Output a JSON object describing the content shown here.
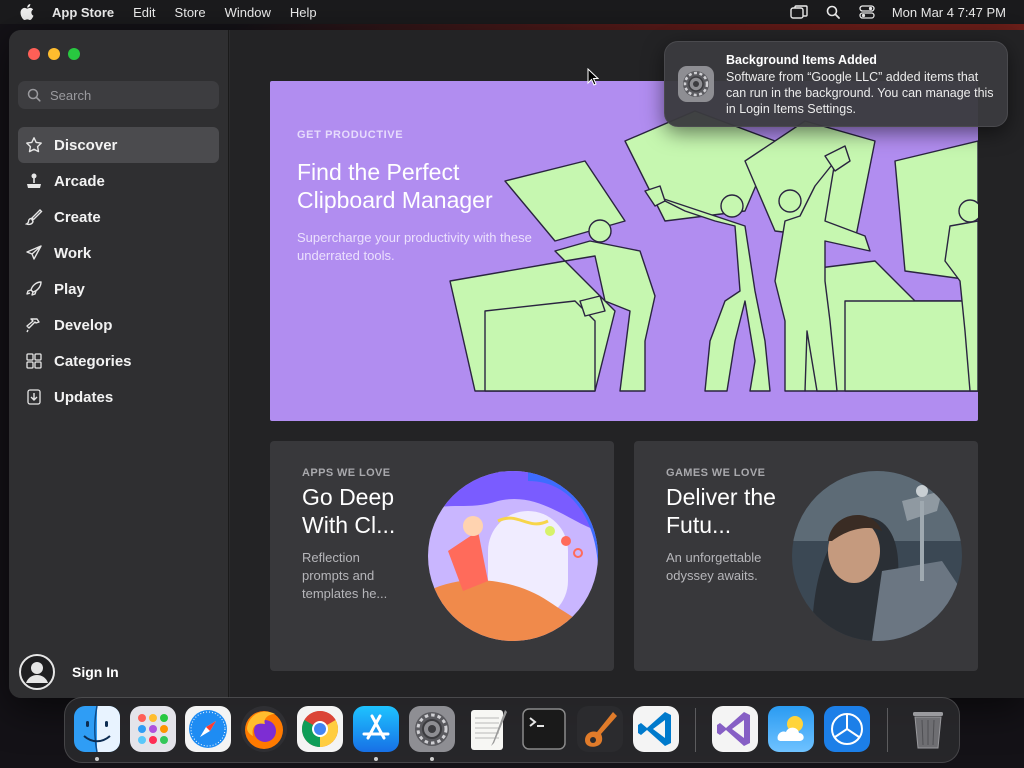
{
  "menubar": {
    "app": "App Store",
    "items": [
      "Edit",
      "Store",
      "Window",
      "Help"
    ],
    "clock": "Mon Mar 4  7:47 PM",
    "status_icons": [
      "screen-mirroring-icon",
      "spotlight-icon",
      "control-center-icon"
    ]
  },
  "sidebar": {
    "search_placeholder": "Search",
    "items": [
      {
        "label": "Discover",
        "icon": "star-icon",
        "active": true
      },
      {
        "label": "Arcade",
        "icon": "joystick-icon"
      },
      {
        "label": "Create",
        "icon": "brush-icon"
      },
      {
        "label": "Work",
        "icon": "paper-plane-icon"
      },
      {
        "label": "Play",
        "icon": "rocket-icon"
      },
      {
        "label": "Develop",
        "icon": "hammer-icon"
      },
      {
        "label": "Categories",
        "icon": "grid-icon"
      },
      {
        "label": "Updates",
        "icon": "download-icon"
      }
    ],
    "sign_in": "Sign In"
  },
  "hero": {
    "eyebrow": "GET PRODUCTIVE",
    "title": "Find the Perfect Clipboard Manager",
    "description": "Supercharge your productivity with these underrated tools.",
    "bg_color": "#b18df0",
    "art_color": "#c6f7b0"
  },
  "cards": [
    {
      "eyebrow": "APPS WE LOVE",
      "title": "Go Deep With Cl...",
      "description": "Reflection prompts and templates he..."
    },
    {
      "eyebrow": "GAMES WE LOVE",
      "title": "Deliver the Futu...",
      "description": "An unforgettable odyssey awaits."
    }
  ],
  "notification": {
    "title": "Background Items Added",
    "body": "Software from “Google LLC” added items that can run in the background. You can manage this in Login Items Settings."
  },
  "dock": {
    "apps": [
      "Finder",
      "Launchpad",
      "Safari",
      "Firefox",
      "Chrome",
      "App Store",
      "System Settings",
      "TextEdit",
      "Terminal",
      "GarageBand",
      "Visual Studio Code",
      "Visual Studio",
      "Weather",
      "Xcode Instruments",
      "Trash"
    ]
  }
}
